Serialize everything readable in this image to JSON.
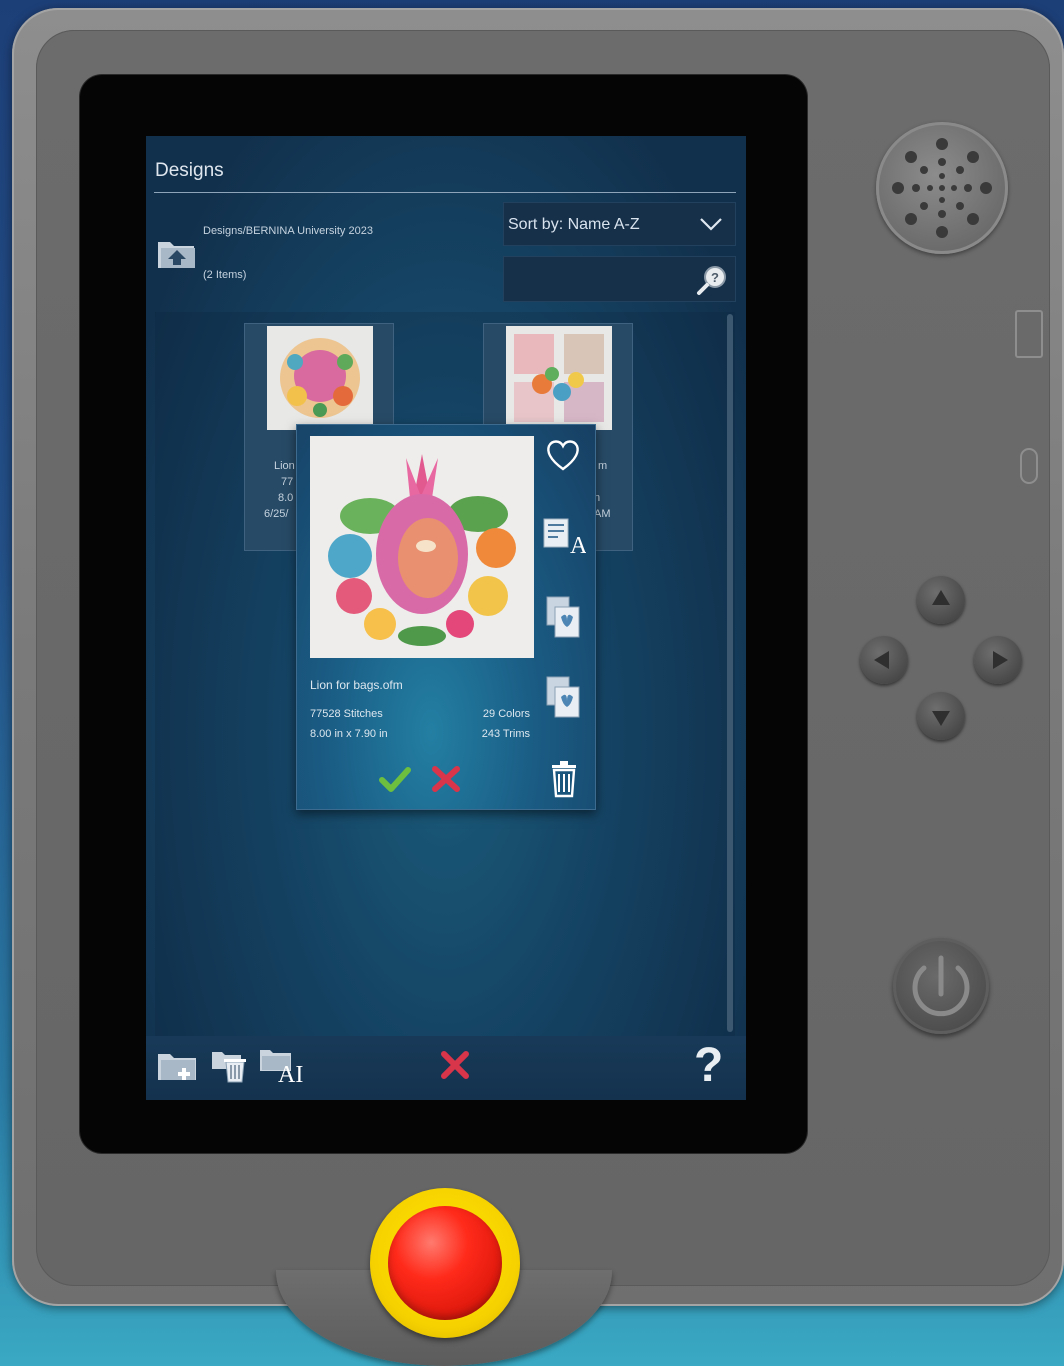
{
  "screen": {
    "title": "Designs",
    "path": "Designs/BERNINA University 2023",
    "item_count": "(2 Items)",
    "sort_label": "Sort by: Name A-Z",
    "search_value": ""
  },
  "tiles": [
    {
      "line1": "Lion",
      "line2": "77",
      "line3": "8.0",
      "line4": "6/25/"
    },
    {
      "line1": "m",
      "line2": "",
      "line3": "n",
      "line4": "AM"
    }
  ],
  "popup": {
    "name": "Lion for bags.ofm",
    "stitches": "77528 Stitches",
    "size": "8.00 in x 7.90 in",
    "colors": "29 Colors",
    "trims": "243 Trims"
  },
  "bottom_bar": {
    "help_label": "?"
  },
  "colors": {
    "accent_green": "#6dbf3f",
    "cancel_red": "#d8344a",
    "start_red": "#ff2a1a",
    "start_yellow": "#ffe600"
  },
  "icons": [
    "folder-up-icon",
    "chevron-down-icon",
    "search-icon",
    "heart-icon",
    "rename-icon",
    "copy-design-icon",
    "paste-design-icon",
    "confirm-icon",
    "cancel-icon",
    "trash-icon",
    "new-folder-icon",
    "delete-folder-icon",
    "rename-folder-icon",
    "help-icon",
    "speaker-grille",
    "usb-port",
    "dpad-up-icon",
    "dpad-left-icon",
    "dpad-right-icon",
    "dpad-down-icon",
    "power-icon"
  ]
}
